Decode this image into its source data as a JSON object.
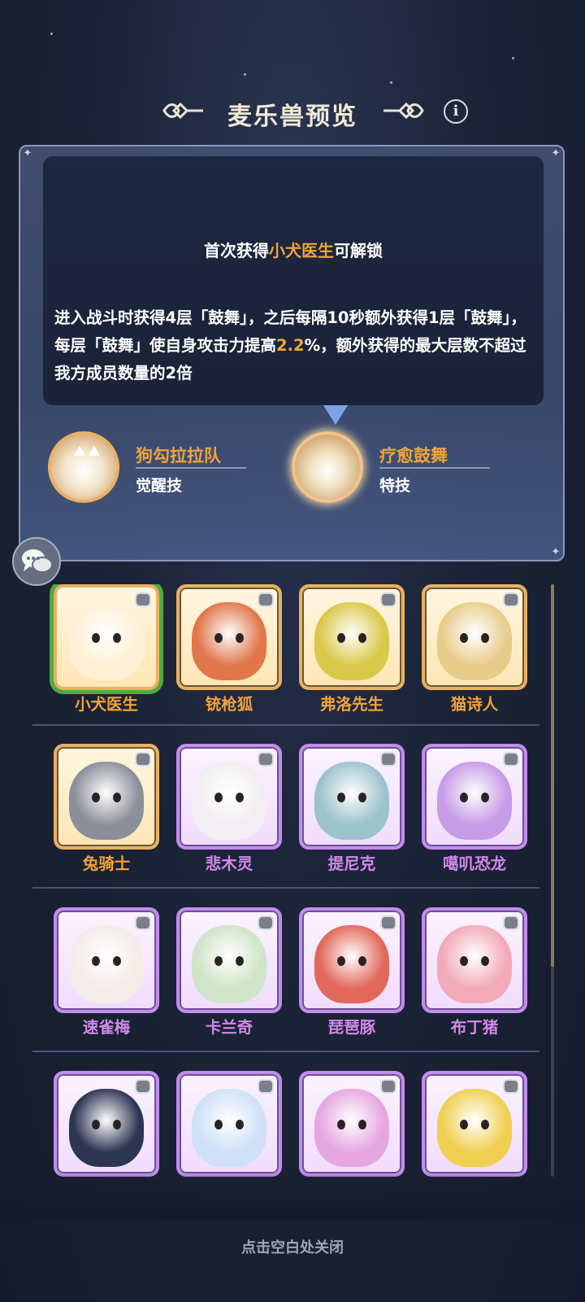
{
  "header": {
    "title": "麦乐兽预览"
  },
  "detail": {
    "unlock_prefix": "首次获得",
    "unlock_name": "小犬医生",
    "unlock_suffix": "可解锁",
    "desc_part1": "进入战斗时获得4层「鼓舞」，之后每隔10秒额外获得1层「鼓舞」，每层「鼓舞」使自身攻击力提高",
    "desc_pct": "2.2",
    "desc_part2": "%，额外获得的最大层数不超过我方成员数量的2倍"
  },
  "skills": [
    {
      "name": "狗勾拉拉队",
      "type": "觉醒技"
    },
    {
      "name": "疗愈鼓舞",
      "type": "特技"
    }
  ],
  "creatures": [
    {
      "name": "小犬医生",
      "rarity": "gold",
      "color": "#fff1d6",
      "selected": true
    },
    {
      "name": "铳枪狐",
      "rarity": "gold",
      "color": "#e0764a"
    },
    {
      "name": "弗洛先生",
      "rarity": "gold",
      "color": "#d9c84a"
    },
    {
      "name": "猫诗人",
      "rarity": "gold",
      "color": "#e8cc8a"
    },
    {
      "name": "兔骑士",
      "rarity": "gold",
      "color": "#8b8f99"
    },
    {
      "name": "悲木灵",
      "rarity": "purple",
      "color": "#f2eef2"
    },
    {
      "name": "提尼克",
      "rarity": "purple",
      "color": "#9cc2cc"
    },
    {
      "name": "噶叽恐龙",
      "rarity": "purple",
      "color": "#c79be6"
    },
    {
      "name": "速雀梅",
      "rarity": "purple",
      "color": "#f4ece8"
    },
    {
      "name": "卡兰奇",
      "rarity": "purple",
      "color": "#cfe4c8"
    },
    {
      "name": "琵琶豚",
      "rarity": "purple",
      "color": "#e2685a"
    },
    {
      "name": "布丁猪",
      "rarity": "purple",
      "color": "#f2a9b8"
    },
    {
      "name": "",
      "rarity": "purple",
      "color": "#2c3552"
    },
    {
      "name": "",
      "rarity": "purple",
      "color": "#cfe0f7"
    },
    {
      "name": "",
      "rarity": "purple",
      "color": "#e6a6e0"
    },
    {
      "name": "",
      "rarity": "purple",
      "color": "#f0cf52"
    }
  ],
  "footer": {
    "close_hint": "点击空白处关闭"
  }
}
